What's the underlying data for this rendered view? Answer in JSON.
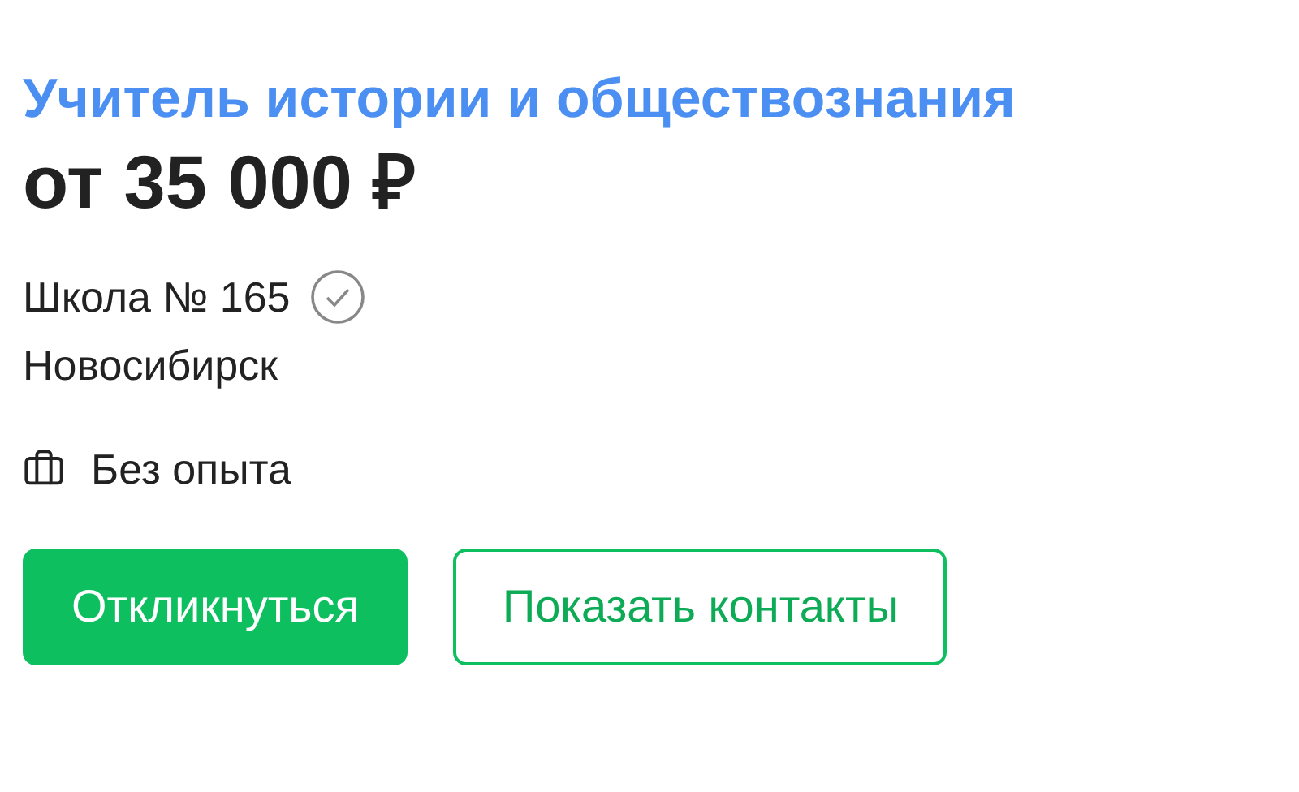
{
  "vacancy": {
    "title": "Учитель истории и обществознания",
    "salary": "от 35 000 ₽",
    "employer": {
      "name": "Школа № 165",
      "verified": true
    },
    "city": "Новосибирск",
    "experience": "Без опыта"
  },
  "buttons": [
    {
      "label": "Откликнуться",
      "kind": "primary"
    },
    {
      "label": "Показать контакты",
      "kind": "outline"
    }
  ]
}
